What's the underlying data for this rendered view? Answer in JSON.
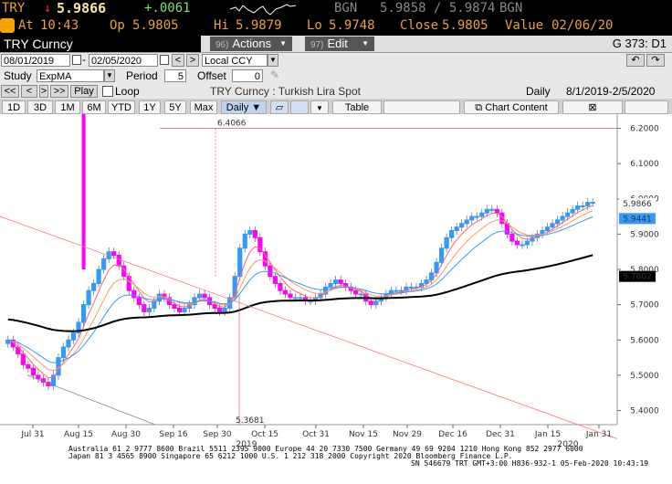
{
  "quote": {
    "ticker": "TRY",
    "arrow": "↓",
    "price": "5.9866",
    "change": "+.0061",
    "at_label": "At",
    "time": "10:43",
    "op_label": "Op",
    "open": "5.9805",
    "hi_label": "Hi",
    "high": "5.9879",
    "lo_label": "Lo",
    "low": "5.9748",
    "bgn_label1": "BGN",
    "bid_ask": "5.9858 / 5.9874",
    "bgn_label2": "BGN",
    "close_label": "Close",
    "close": "5.9805",
    "value_label": "Value",
    "value_date": "02/06/20"
  },
  "titlebar": {
    "title": "TRY Curncy",
    "actions_num": "96)",
    "actions": "Actions",
    "edit_num": "97)",
    "edit": "Edit",
    "right": "G 373: D1"
  },
  "form": {
    "start_date": "08/01/2019",
    "end_date": "02/05/2020",
    "currency": "Local CCY",
    "study_label": "Study",
    "study": "ExpMA",
    "period_label": "Period",
    "period": "5",
    "offset_label": "Offset",
    "offset": "0",
    "play": "Play",
    "loop": "Loop",
    "chart_title": "TRY Curncy : Turkish Lira Spot",
    "freq": "Daily",
    "range": "8/1/2019-2/5/2020"
  },
  "tabs": [
    "1D",
    "3D",
    "1M",
    "6M",
    "YTD",
    "1Y",
    "5Y",
    "Max",
    "Daily ▼"
  ],
  "tools": {
    "table": "Table",
    "chart_content": "Chart Content"
  },
  "chart_data": {
    "type": "candlestick",
    "y_ticks": [
      "6.2000",
      "6.1000",
      "6.0000",
      "5.9000",
      "5.8000",
      "5.7000",
      "5.6000",
      "5.5000",
      "5.4000"
    ],
    "ylim": [
      5.36,
      6.24
    ],
    "x_ticks": [
      "Jul 31",
      "Aug 15",
      "Aug 30",
      "Sep 16",
      "Sep 30",
      "Oct 15",
      "Oct 31",
      "Nov 15",
      "Nov 29",
      "Dec 16",
      "Dec 31",
      "Jan 15",
      "Jan 31"
    ],
    "x_years": [
      "2019",
      "2020"
    ],
    "last_price": "5.9866",
    "ema_label": "5.9441",
    "ma_label": "5.7802",
    "annot_top": "6.4066",
    "annot_bottom": "5.3681",
    "closes": [
      5.6,
      5.58,
      5.56,
      5.53,
      5.52,
      5.5,
      5.49,
      5.48,
      5.47,
      5.5,
      5.55,
      5.58,
      5.6,
      5.62,
      5.65,
      5.7,
      5.74,
      5.76,
      5.8,
      5.83,
      5.85,
      5.84,
      5.81,
      5.78,
      5.74,
      5.72,
      5.7,
      5.68,
      5.69,
      5.71,
      5.73,
      5.72,
      5.7,
      5.69,
      5.68,
      5.69,
      5.7,
      5.72,
      5.73,
      5.72,
      5.7,
      5.69,
      5.68,
      5.69,
      5.72,
      5.78,
      5.86,
      5.9,
      5.91,
      5.89,
      5.85,
      5.81,
      5.78,
      5.76,
      5.74,
      5.73,
      5.72,
      5.72,
      5.72,
      5.71,
      5.71,
      5.72,
      5.73,
      5.75,
      5.76,
      5.77,
      5.76,
      5.75,
      5.74,
      5.73,
      5.73,
      5.71,
      5.7,
      5.71,
      5.72,
      5.73,
      5.74,
      5.74,
      5.74,
      5.75,
      5.75,
      5.75,
      5.76,
      5.77,
      5.79,
      5.82,
      5.86,
      5.89,
      5.91,
      5.92,
      5.93,
      5.94,
      5.95,
      5.95,
      5.96,
      5.97,
      5.97,
      5.96,
      5.93,
      5.9,
      5.88,
      5.87,
      5.87,
      5.88,
      5.89,
      5.9,
      5.91,
      5.92,
      5.93,
      5.94,
      5.95,
      5.96,
      5.97,
      5.98,
      5.98,
      5.99,
      5.99
    ],
    "footer_line1": "Australia 61 2 9777 8600 Brazil 5511 2395 9000 Europe 44 20 7330 7500 Germany 49 69 9204 1210 Hong Kong 852 2977 6000",
    "footer_line2": "Japan 81 3 4565 8900        Singapore 65 6212 1000      U.S. 1 212 318 2000             Copyright 2020 Bloomberg Finance L.P.",
    "footer_line3": "SN 546679 TRT  GMT+3:00 H836-932-1 05-Feb-2020 10:43:19"
  },
  "colors": {
    "up": "#3399ff",
    "down": "#ff00ff",
    "ema_short": "#ff6666",
    "ema_mid": "#ff9966",
    "ema_long": "#3399ff",
    "ma": "#000000"
  }
}
